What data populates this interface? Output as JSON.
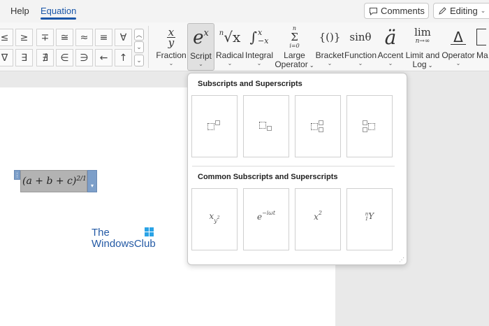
{
  "tabs": {
    "help": "Help",
    "equation": "Equation"
  },
  "top_buttons": {
    "comments": "Comments",
    "editing": "Editing"
  },
  "symbols": [
    "≤",
    "≥",
    "∓",
    "≅",
    "≈",
    "≡",
    "∀",
    "∇",
    "∃",
    "∄",
    "∈",
    "∋",
    "←",
    "↑"
  ],
  "ribbon": {
    "fraction": {
      "label": "Fraction",
      "glyph_top": "x",
      "glyph_bottom": "y"
    },
    "script": {
      "label": "Script",
      "glyph": "e",
      "glyph_sup": "x"
    },
    "radical": {
      "label": "Radical",
      "glyph_index": "n",
      "glyph": "√x"
    },
    "integral": {
      "label": "Integral",
      "glyph": "∫",
      "glyph_top": "x",
      "glyph_bottom": "−x"
    },
    "large_operator": {
      "label_line1": "Large",
      "label_line2": "Operator",
      "glyph_top": "n",
      "glyph": "Σ",
      "glyph_bottom": "i=0"
    },
    "bracket": {
      "label": "Bracket",
      "glyph": "{()}"
    },
    "function": {
      "label": "Function",
      "glyph": "sinθ"
    },
    "accent": {
      "label": "Accent",
      "glyph": "ä"
    },
    "limit_log": {
      "label_line1": "Limit and",
      "label_line2": "Log",
      "glyph": "lim",
      "glyph_bottom": "n→∞"
    },
    "operator": {
      "label": "Operator",
      "glyph": "Δ"
    },
    "matrix": {
      "label": "Ma"
    }
  },
  "document": {
    "equation": {
      "text": "(a + b + c)",
      "sup": "2/1"
    }
  },
  "watermark": {
    "line1": "The",
    "line2": "WindowsClub"
  },
  "panel": {
    "section1_title": "Subscripts and Superscripts",
    "section2_title": "Common Subscripts and Superscripts",
    "common": [
      {
        "base": "x",
        "sub": "y",
        "subsup": "2"
      },
      {
        "base": "e",
        "sup": "−iωt"
      },
      {
        "base": "x",
        "sup": "2"
      },
      {
        "presup": "n",
        "presub": "1",
        "base": "Y"
      }
    ]
  },
  "colors": {
    "accent": "#1a56a8",
    "equation_handle": "#7d9fc9",
    "equation_bg": "#b3b3b3",
    "logo": "#2aa3e6"
  },
  "icons": {
    "comments": "comment-icon",
    "editing": "pencil-icon"
  }
}
